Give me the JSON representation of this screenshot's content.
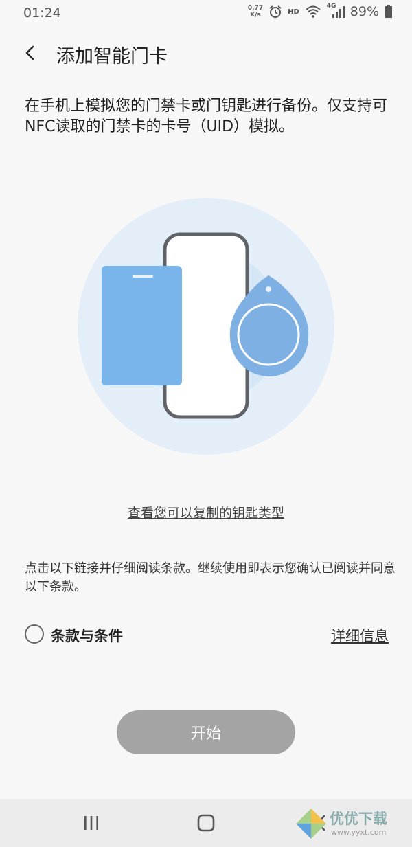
{
  "status_bar": {
    "time": "01:24",
    "net_speed_value": "0.77",
    "net_speed_unit": "K/s",
    "hd_label": "HD",
    "network_label": "4G",
    "battery": "89%"
  },
  "header": {
    "title": "添加智能门卡"
  },
  "description": "在手机上模拟您的门禁卡或门钥匙进行备份。仅支持可NFC读取的门禁卡的卡号（UID）模拟。",
  "key_types_link": "查看您可以复制的钥匙类型",
  "terms_note": "点击以下链接并仔细阅读条款。继续使用即表示您确认已阅读并同意以下条款。",
  "terms": {
    "label": "条款与条件",
    "details_link": "详细信息",
    "checked": false
  },
  "start_button": "开始",
  "watermark": {
    "text": "优优下载",
    "url": "www.yyxt.com"
  },
  "colors": {
    "background": "#f7f7f7",
    "illustration_outer": "#e3eef8",
    "illustration_inner": "#d5e6f5",
    "card_blue": "#79b4ea",
    "fob_blue": "#7fb0e3",
    "phone_frame": "#5f6266",
    "button_disabled": "#a4a4a4"
  }
}
